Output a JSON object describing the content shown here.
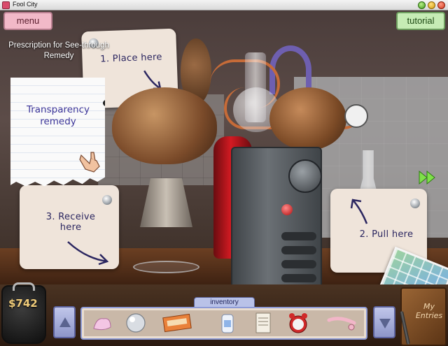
{
  "window": {
    "title": "Fool City"
  },
  "buttons": {
    "menu": "menu",
    "tutorial": "tutorial"
  },
  "recipe": {
    "caption": "Prescription for See-through Remedy",
    "title": "Transparency remedy"
  },
  "instructions": {
    "place": "1. Place here",
    "pull": "2. Pull here",
    "receive": "3. Receive here"
  },
  "inventory": {
    "label": "inventory",
    "items": [
      {
        "icon": "pink-powder-icon"
      },
      {
        "icon": "glass-marble-icon"
      },
      {
        "icon": "ticket-pack-icon"
      },
      {
        "icon": "lotion-bottle-icon"
      },
      {
        "icon": "paper-note-icon"
      },
      {
        "icon": "alarm-clock-icon"
      },
      {
        "icon": "pink-tool-icon"
      }
    ]
  },
  "wallet": {
    "amount": "$742"
  },
  "journal": {
    "label": "My Entries"
  },
  "colors": {
    "menu": "#f2b9c8",
    "tutorial": "#c6ecb5",
    "inventory_frame": "#8e9bd6",
    "ink": "#2b2660"
  }
}
